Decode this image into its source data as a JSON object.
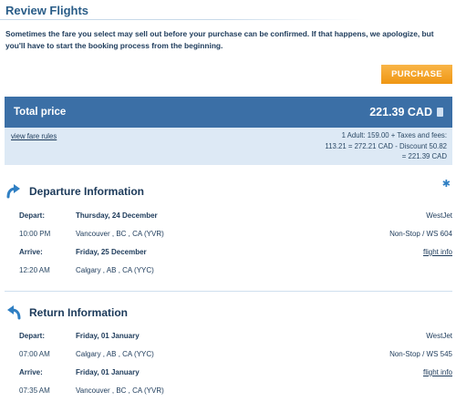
{
  "page": {
    "title": "Review Flights",
    "warning": "Sometimes the fare you select may sell out before your purchase can be confirmed. If that happens, we apologize, but you'll have to start the booking process from the beginning.",
    "purchase_label": "PURCHASE"
  },
  "total": {
    "label": "Total price",
    "amount": "221.39 CAD",
    "fare_rules_link": "view fare rules",
    "breakdown": [
      "1 Adult: 159.00 + Taxes and fees:",
      "113.21 = 272.21 CAD - Discount 50.82",
      "= 221.39 CAD"
    ]
  },
  "departure": {
    "heading": "Departure Information",
    "depart_label": "Depart:",
    "depart_date": "Thursday, 24 December",
    "airline": "WestJet",
    "depart_time": "10:00 PM",
    "from": "Vancouver , BC , CA (YVR)",
    "flight": "Non-Stop / WS 604",
    "arrive_label": "Arrive:",
    "arrive_date": "Friday, 25 December",
    "flight_info": "flight info",
    "arrive_time": "12:20 AM",
    "to": "Calgary , AB , CA (YYC)"
  },
  "return": {
    "heading": "Return Information",
    "depart_label": "Depart:",
    "depart_date": "Friday, 01 January",
    "airline": "WestJet",
    "depart_time": "07:00 AM",
    "from": "Calgary , AB , CA (YYC)",
    "flight": "Non-Stop / WS 545",
    "arrive_label": "Arrive:",
    "arrive_date": "Friday, 01 January",
    "flight_info": "flight info",
    "arrive_time": "07:35 AM",
    "to": "Vancouver , BC , CA (YVR)"
  },
  "icons": {
    "departure": "departure-arrow-icon",
    "return": "return-arrow-icon",
    "plane": "plane-icon",
    "currency": "currency-icon"
  },
  "colors": {
    "accent": "#3b6fa6",
    "heading": "#2a5d88",
    "purchase_button": "#f5a623",
    "fare_box": "#dde9f5"
  }
}
